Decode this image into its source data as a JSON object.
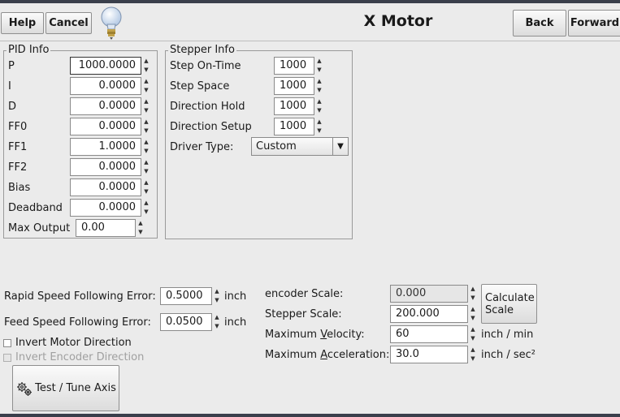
{
  "header": {
    "help": "Help",
    "cancel": "Cancel",
    "title": "X Motor",
    "back": "Back",
    "forward": "Forward"
  },
  "pid": {
    "legend": "PID Info",
    "rows": [
      {
        "label": "P",
        "value": "1000.0000"
      },
      {
        "label": "I",
        "value": "0.0000"
      },
      {
        "label": "D",
        "value": "0.0000"
      },
      {
        "label": "FF0",
        "value": "0.0000"
      },
      {
        "label": "FF1",
        "value": "1.0000"
      },
      {
        "label": "FF2",
        "value": "0.0000"
      },
      {
        "label": "Bias",
        "value": "0.0000"
      },
      {
        "label": "Deadband",
        "value": "0.0000"
      }
    ],
    "max_output_label": "Max Output",
    "max_output": "0.00"
  },
  "stepper": {
    "legend": "Stepper Info",
    "rows": [
      {
        "label": "Step On-Time",
        "value": "1000"
      },
      {
        "label": "Step Space",
        "value": "1000"
      },
      {
        "label": "Direction Hold",
        "value": "1000"
      },
      {
        "label": "Direction Setup",
        "value": "1000"
      }
    ],
    "driver_label": "Driver Type:",
    "driver": "Custom"
  },
  "following": {
    "rapid_label": "Rapid Speed Following Error:",
    "rapid": "0.5000",
    "feed_label": "Feed Speed Following Error:",
    "feed": "0.0500",
    "unit": "inch"
  },
  "options": {
    "invert_motor": "Invert Motor Direction",
    "invert_encoder": "Invert Encoder Direction"
  },
  "test_button": "Test / Tune Axis",
  "scale": {
    "encoder_label": "encoder Scale:",
    "encoder": "0.000",
    "stepper_label": "Stepper Scale:",
    "stepper": "200.000",
    "calc_line1": "Calculate",
    "calc_line2": "Scale",
    "vel_pre": "Maximum ",
    "vel_u": "V",
    "vel_post": "elocity:",
    "velocity": "60",
    "vel_unit": "inch / min",
    "acc_pre": "Maximum ",
    "acc_u": "A",
    "acc_post": "cceleration:",
    "acceleration": "30.0",
    "acc_unit": "inch / sec²"
  },
  "icons": {
    "hint": "lightbulb-icon",
    "test": "gears-icon"
  }
}
